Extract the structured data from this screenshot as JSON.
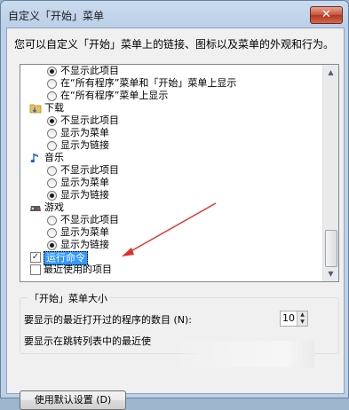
{
  "window": {
    "title": "自定义「开始」菜单",
    "close_symbol": "✕",
    "description": "您可以自定义「开始」菜单上的链接、图标以及菜单的外观和行为。"
  },
  "list": {
    "rows": [
      {
        "type": "radio",
        "indent": 2,
        "checked": true,
        "label": "不显示此项目"
      },
      {
        "type": "radio",
        "indent": 2,
        "checked": false,
        "label": "在“所有程序”菜单和「开始」菜单上显示"
      },
      {
        "type": "radio",
        "indent": 2,
        "checked": false,
        "label": "在“所有程序”菜单上显示"
      },
      {
        "type": "header",
        "icon": "folder-icon",
        "label": "下载"
      },
      {
        "type": "radio",
        "indent": 2,
        "checked": true,
        "label": "不显示此项目"
      },
      {
        "type": "radio",
        "indent": 2,
        "checked": false,
        "label": "显示为菜单"
      },
      {
        "type": "radio",
        "indent": 2,
        "checked": false,
        "label": "显示为链接"
      },
      {
        "type": "header",
        "icon": "music-note-icon",
        "label": "音乐"
      },
      {
        "type": "radio",
        "indent": 2,
        "checked": false,
        "label": "不显示此项目"
      },
      {
        "type": "radio",
        "indent": 2,
        "checked": false,
        "label": "显示为菜单"
      },
      {
        "type": "radio",
        "indent": 2,
        "checked": true,
        "label": "显示为链接"
      },
      {
        "type": "header",
        "icon": "games-icon",
        "label": "游戏"
      },
      {
        "type": "radio",
        "indent": 2,
        "checked": false,
        "label": "不显示此项目"
      },
      {
        "type": "radio",
        "indent": 2,
        "checked": false,
        "label": "显示为菜单"
      },
      {
        "type": "radio",
        "indent": 2,
        "checked": true,
        "label": "显示为链接"
      },
      {
        "type": "checkbox",
        "checked": true,
        "selected": true,
        "label": "运行命令"
      },
      {
        "type": "checkbox",
        "checked": false,
        "selected": false,
        "label": "最近使用的项目"
      }
    ]
  },
  "size_group": {
    "title": "「开始」菜单大小",
    "recent_programs_label": "要显示的最近打开过的程序的数目 (N):",
    "recent_programs_value": "10",
    "jumplist_label": "要显示在跳转列表中的最近使"
  },
  "defaults_button": "使用默认设置 (D)",
  "colors": {
    "selection": "#3399ff",
    "annotation_arrow": "#e0302a"
  }
}
